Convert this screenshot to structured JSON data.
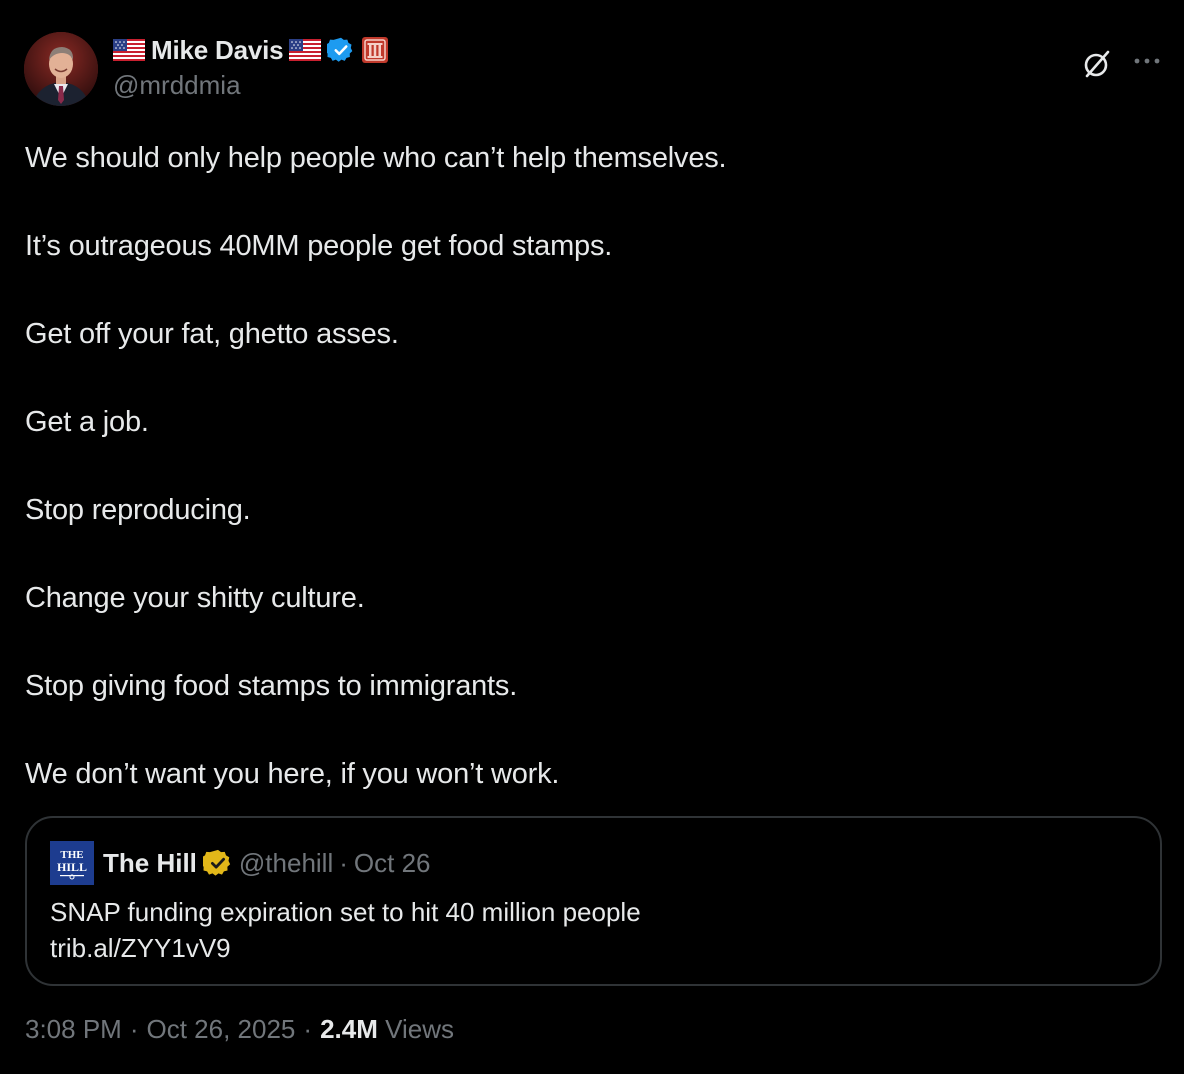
{
  "author": {
    "display_name": "Mike Davis",
    "handle": "@mrddmia",
    "flag_icon": "us-flag-icon",
    "verified_color": "#1d9bf0",
    "affiliate_badge_color": "#c0392b"
  },
  "tweet": {
    "lines": [
      "We should only help people who can’t help themselves.",
      "It’s outrageous 40MM people get food stamps.",
      "Get off your fat, ghetto asses.",
      "Get a job.",
      "Stop reproducing.",
      "Change your shitty culture.",
      "Stop giving food stamps to immigrants.",
      "We don’t want you here, if you won’t work."
    ]
  },
  "quote": {
    "logo_text_1": "THE",
    "logo_text_2": "HILL",
    "name": "The Hill",
    "handle": "@thehill",
    "separator": "·",
    "date": "Oct 26",
    "verified_color": "#e2b719",
    "text_line_1": "SNAP funding expiration set to hit 40 million people",
    "text_line_2": "trib.al/ZYY1vV9"
  },
  "meta": {
    "time": "3:08 PM",
    "separator": "·",
    "date": "Oct 26, 2025",
    "separator_2": "·",
    "views_count": "2.4M",
    "views_label": "Views"
  },
  "icons": {
    "grok": "grok-icon",
    "more": "more-icon"
  }
}
